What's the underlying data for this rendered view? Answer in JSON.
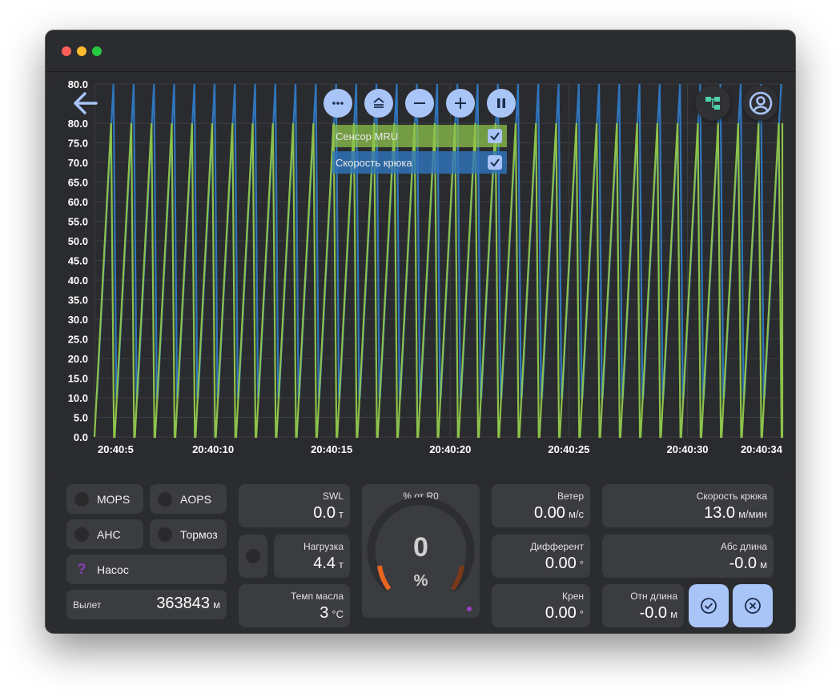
{
  "toolbar": {
    "buttons": [
      "more",
      "autoscale",
      "zoom-out",
      "zoom-in",
      "pause"
    ]
  },
  "legend": {
    "series": [
      {
        "label": "Сенсор MRU",
        "checked": true,
        "color": "#8cc24b"
      },
      {
        "label": "Скорость крюка",
        "checked": true,
        "color": "#2f76be"
      }
    ]
  },
  "status": {
    "mops": "MOPS",
    "aops": "AOPS",
    "ahc": "AHC",
    "brake": "Тормоз",
    "pump": "Насос",
    "pump_state_icon": "?"
  },
  "metrics": {
    "outreach": {
      "label": "Вылет",
      "value": "363843",
      "unit": "м"
    },
    "swl": {
      "label": "SWL",
      "value": "0.0",
      "unit": "т"
    },
    "load": {
      "label": "Нагрузка",
      "value": "4.4",
      "unit": "т"
    },
    "oil_temp": {
      "label": "Темп масла",
      "value": "3",
      "unit": "°C"
    },
    "wind": {
      "label": "Ветер",
      "value": "0.00",
      "unit": "м/с"
    },
    "trim": {
      "label": "Дифферент",
      "value": "0.00",
      "unit": "°"
    },
    "heel": {
      "label": "Крен",
      "value": "0.00",
      "unit": "°"
    },
    "hook_speed": {
      "label": "Скорость крюка",
      "value": "13.0",
      "unit": "м/мин"
    },
    "abs_length": {
      "label": "Абс длина",
      "value": "-0.0",
      "unit": "м"
    },
    "rel_length": {
      "label": "Отн длина",
      "value": "-0.0",
      "unit": "м"
    }
  },
  "gauge": {
    "title": "% от R0",
    "value": "0",
    "unit": "%",
    "percent": 0
  },
  "colors": {
    "mru": "#8cc24b",
    "hook_speed": "#2f76be",
    "accent": "#a9c4f7",
    "gauge_arc": "#e8651f"
  },
  "chart_data": {
    "type": "line",
    "y_ticks": [
      "0.0",
      "5.0",
      "10.0",
      "15.0",
      "20.0",
      "25.0",
      "30.0",
      "35.0",
      "40.0",
      "45.0",
      "50.0",
      "55.0",
      "60.0",
      "65.0",
      "70.0",
      "75.0",
      "80.0",
      "80.0"
    ],
    "x_ticks": [
      "20:40:5",
      "20:40:10",
      "20:40:15",
      "20:40:20",
      "20:40:25",
      "20:40:30",
      "20:40:34"
    ],
    "ylim": [
      0,
      90
    ],
    "x_range_seconds": [
      5,
      34
    ],
    "grid": true,
    "series": [
      {
        "name": "Сенсор MRU",
        "pattern": "sawtooth",
        "min": 0,
        "max": 80,
        "cycles": 34
      },
      {
        "name": "Скорость крюка",
        "pattern": "sawtooth",
        "min": 10,
        "max": 90,
        "cycles": 34
      }
    ]
  }
}
